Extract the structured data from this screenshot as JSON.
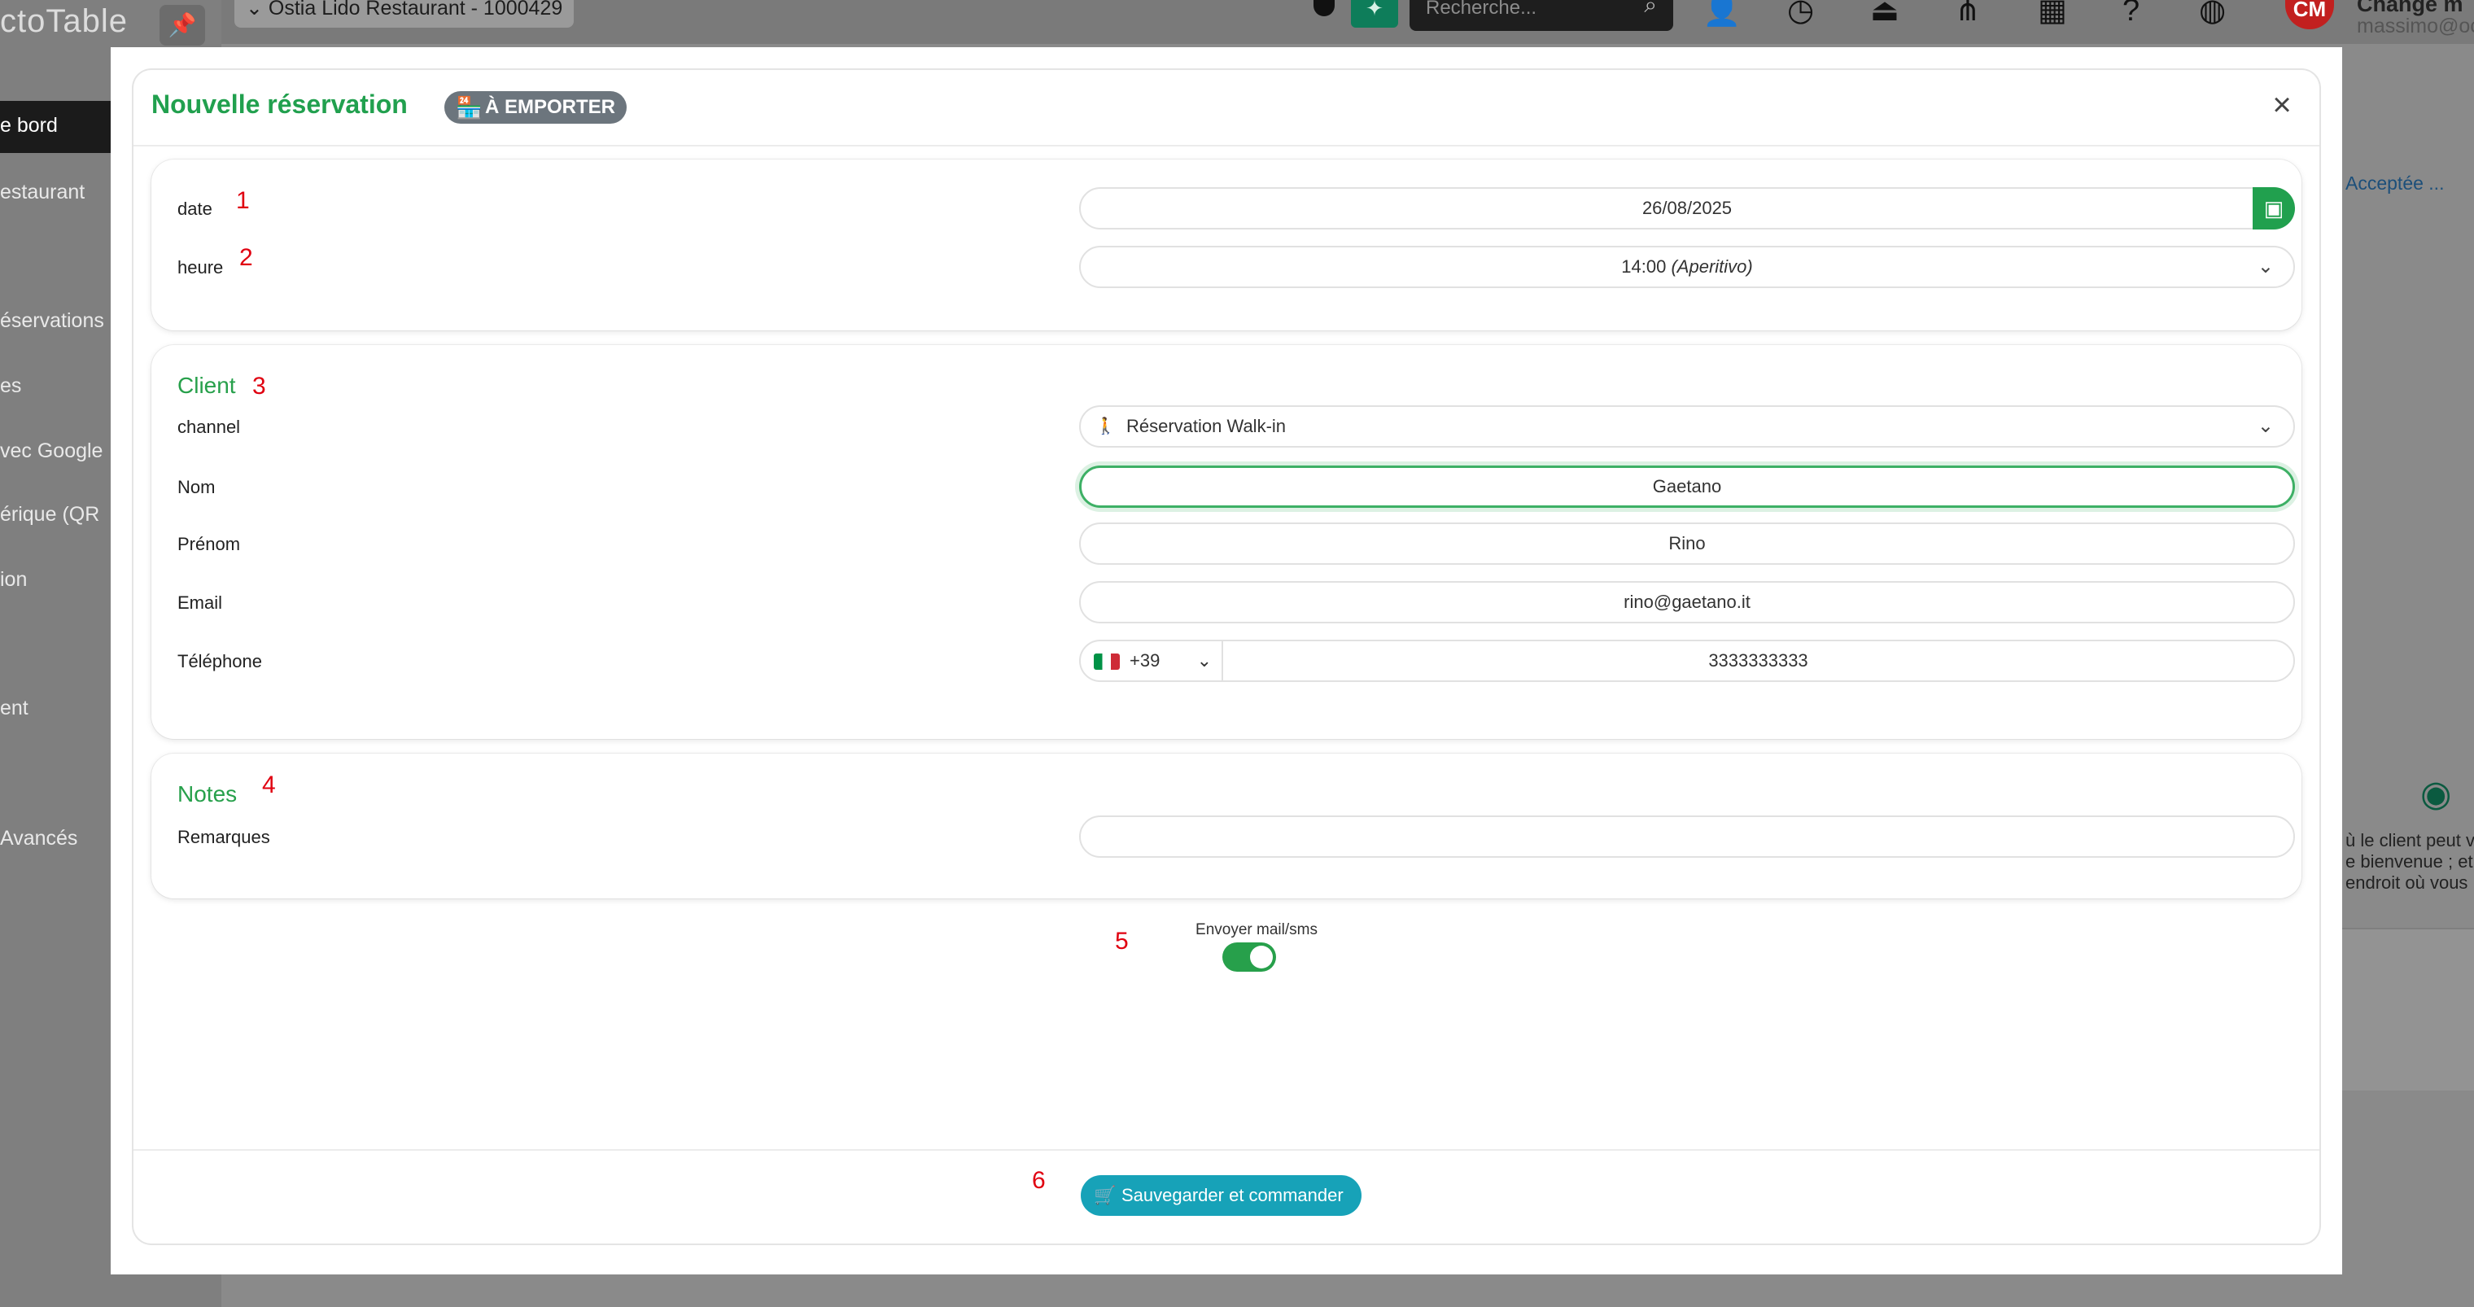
{
  "app": {
    "logo_text": "ctoTable",
    "restaurant_selector": "Ostia Lido Restaurant - 1000429",
    "search_placeholder": "Recherche...",
    "user_initials": "CM",
    "user_name": "Change m",
    "user_email": "massimo@oc"
  },
  "sidebar": {
    "items": [
      "e bord",
      "estaurant",
      "éservations",
      "es",
      "vec Google",
      "érique (QR",
      "ion",
      "ent",
      "Avancés"
    ]
  },
  "background_right": {
    "status_text": "Acceptée ...",
    "text_lines": [
      "ù le client peut v",
      "e bienvenue ; et",
      "endroit où vous"
    ]
  },
  "modal": {
    "title": "Nouvelle réservation",
    "badge": "À EMPORTER",
    "close_icon": "×"
  },
  "date_section": {
    "marker_date": "1",
    "marker_time": "2",
    "date_label": "date",
    "date_value": "26/08/2025",
    "time_label": "heure",
    "time_value": "14:00",
    "time_service": "(Aperitivo)"
  },
  "client_section": {
    "title": "Client",
    "marker": "3",
    "channel_label": "channel",
    "channel_value": "Réservation Walk-in",
    "nom_label": "Nom",
    "nom_value": "Gaetano",
    "prenom_label": "Prénom",
    "prenom_value": "Rino",
    "email_label": "Email",
    "email_value": "rino@gaetano.it",
    "phone_label": "Téléphone",
    "phone_country_code": "+39",
    "phone_value": "3333333333"
  },
  "notes_section": {
    "title": "Notes",
    "marker": "4",
    "remarks_label": "Remarques",
    "remarks_value": ""
  },
  "send_toggle": {
    "marker": "5",
    "label": "Envoyer mail/sms",
    "enabled": true
  },
  "footer": {
    "marker": "6",
    "save_label": "Sauvegarder et commander"
  },
  "colors": {
    "accent_green": "#21a04e",
    "button_teal": "#17a2b8",
    "marker_red": "#e00010",
    "badge_grey": "#6c757d"
  }
}
